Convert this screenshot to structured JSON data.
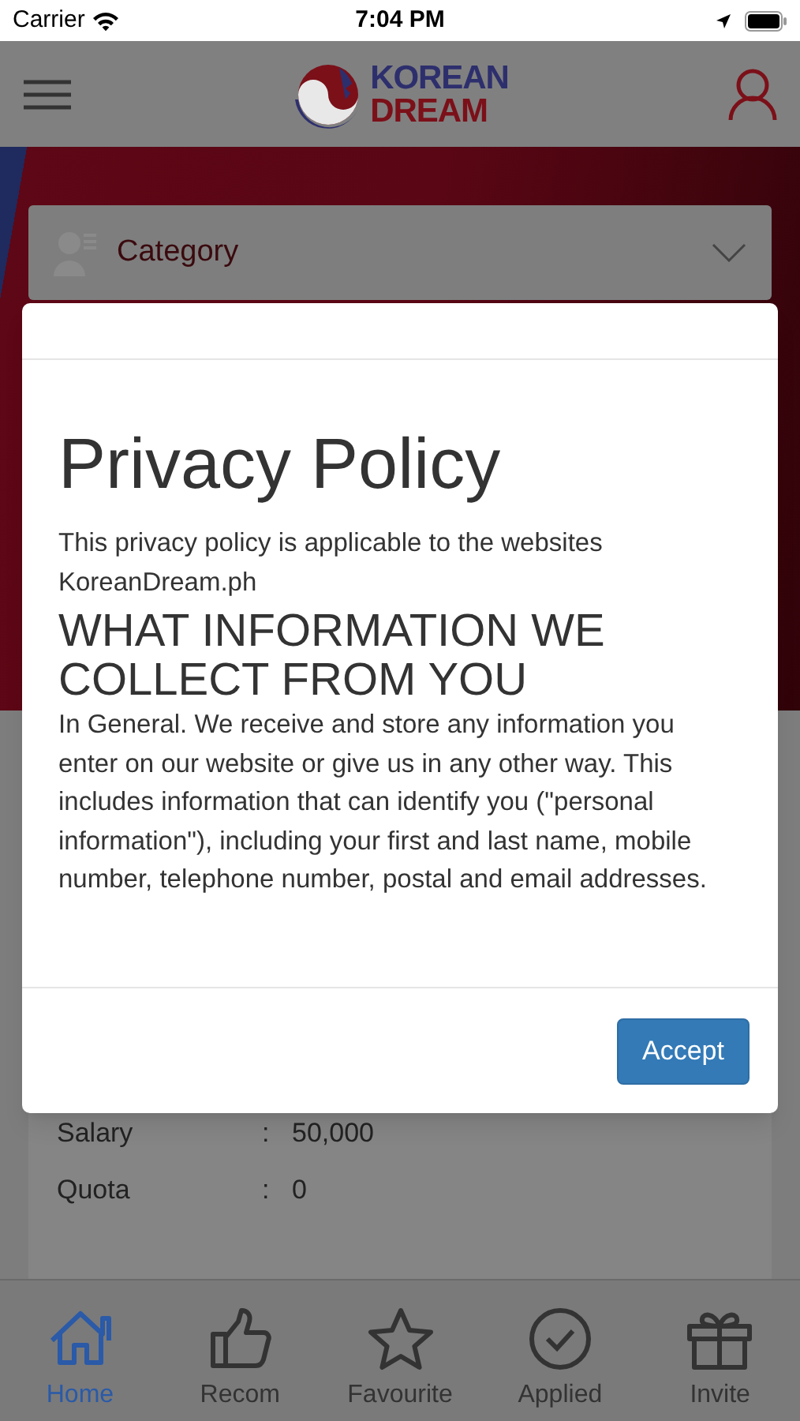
{
  "status_bar": {
    "carrier": "Carrier",
    "time": "7:04 PM"
  },
  "header": {
    "logo_top": "KOREAN",
    "logo_bottom": "DREAM"
  },
  "category_select": {
    "placeholder": "Category"
  },
  "job_details": [
    {
      "label": "Salary",
      "separator": ":",
      "value": "50,000"
    },
    {
      "label": "Quota",
      "separator": ":",
      "value": "0"
    }
  ],
  "modal": {
    "title": "Privacy Policy",
    "blocks": [
      {
        "kind": "paragraph",
        "text": "This privacy policy is applicable to the websites KoreanDream.ph"
      },
      {
        "kind": "heading",
        "text": "WHAT INFORMATION WE COLLECT FROM YOU"
      },
      {
        "kind": "paragraph",
        "text": "In General. We receive and store any information you enter on our website or give us in any other way. This includes information that can identify you (\"personal information\"), including your first and last name, mobile number, telephone number, postal and email addresses."
      }
    ],
    "button": "Accept"
  },
  "tab_bar": [
    {
      "label": "Home",
      "kind": "home",
      "selected": true
    },
    {
      "label": "Recom",
      "kind": "thumb",
      "selected": false
    },
    {
      "label": "Favourite",
      "kind": "star",
      "selected": false
    },
    {
      "label": "Applied",
      "kind": "check",
      "selected": false
    },
    {
      "label": "Invite",
      "kind": "gift",
      "selected": false
    }
  ]
}
